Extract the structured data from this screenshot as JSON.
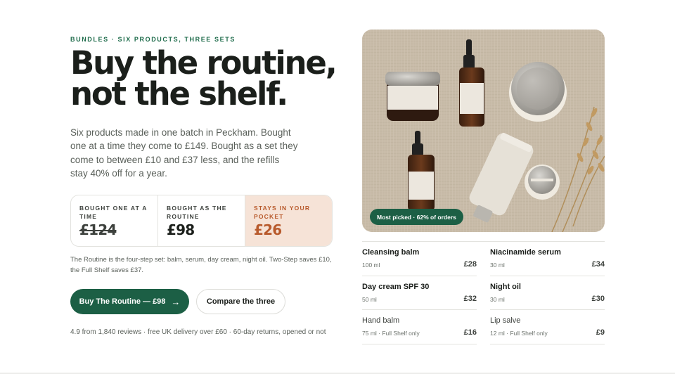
{
  "hero": {
    "eyebrow": "BUNDLES · SIX PRODUCTS, THREE SETS",
    "headline_line1": "Buy the routine,",
    "headline_line2": "not the shelf.",
    "lede": "Six products made in one batch in Peckham. Bought one at a time they come to £149. Bought as a set they come to between £10 and £37 less, and the refills stay 40% off for a year."
  },
  "pricing": [
    {
      "label": "BOUGHT ONE AT A TIME",
      "value": "£124",
      "struck": true
    },
    {
      "label": "BOUGHT AS THE ROUTINE",
      "value": "£98",
      "struck": false
    },
    {
      "label": "STAYS IN YOUR POCKET",
      "value": "£26",
      "struck": false
    }
  ],
  "footnote": "The Routine is the four-step set: balm, serum, day cream, night oil. Two-Step saves £10, the Full Shelf saves £37.",
  "actions": {
    "primary_label": "Buy The Routine — £98",
    "primary_icon": "arrow-right-icon",
    "secondary_label": "Compare the three"
  },
  "trust_line": "4.9 from 1,840 reviews · free UK delivery over £60 · 60-day returns, opened or not",
  "photo": {
    "badge": "Most picked · 62% of orders"
  },
  "products": [
    {
      "name": "Cleansing balm",
      "meta": "100 ml",
      "price": "£28",
      "muted": false
    },
    {
      "name": "Niacinamide serum",
      "meta": "30 ml",
      "price": "£34",
      "muted": false
    },
    {
      "name": "Day cream SPF 30",
      "meta": "50 ml",
      "price": "£32",
      "muted": false
    },
    {
      "name": "Night oil",
      "meta": "30 ml",
      "price": "£30",
      "muted": false
    },
    {
      "name": "Hand balm",
      "meta": "75 ml · Full Shelf only",
      "price": "£16",
      "muted": true
    },
    {
      "name": "Lip salve",
      "meta": "12 ml · Full Shelf only",
      "price": "£9",
      "muted": true
    }
  ],
  "colors": {
    "brand_green": "#1c5f45",
    "savings_accent": "#b85a2c",
    "savings_bg": "#f6e3d7"
  }
}
